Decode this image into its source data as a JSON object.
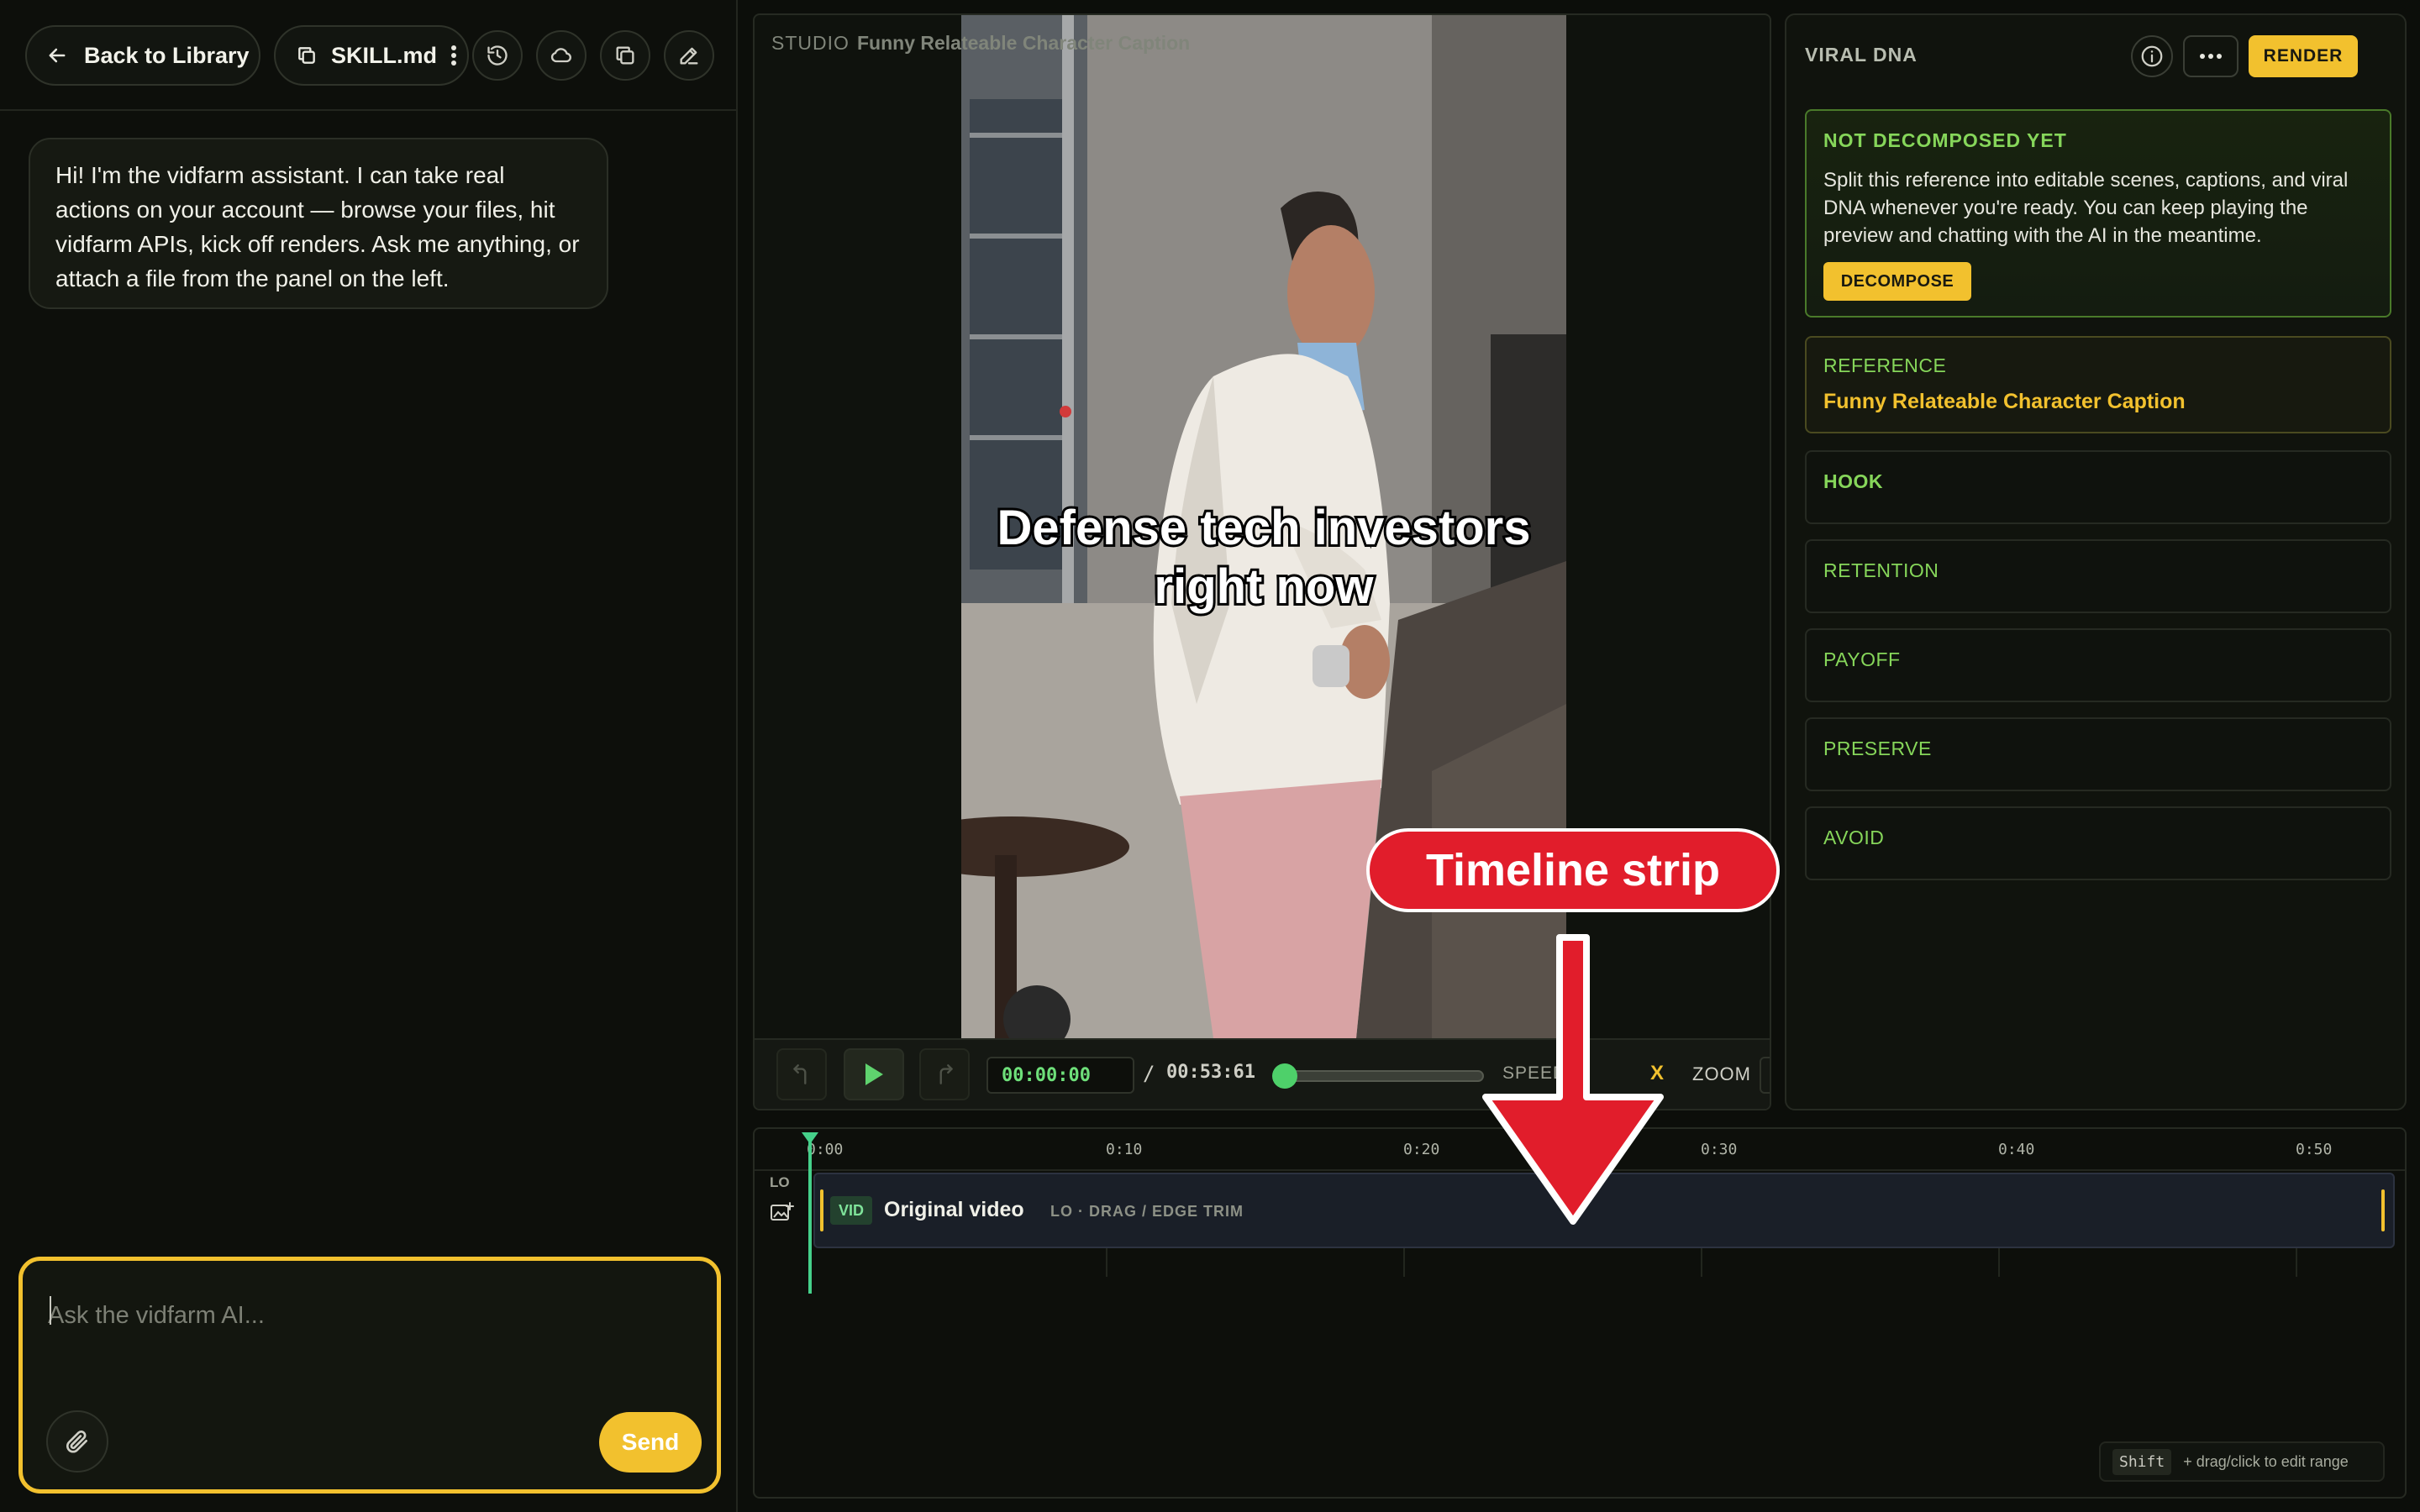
{
  "left_panel": {
    "back_label": "Back to Library",
    "skill_label": "SKILL.md",
    "assistant_message": "Hi! I'm the vidfarm assistant. I can take real actions on your account — browse your files, hit vidfarm APIs, kick off renders. Ask me anything, or attach a file from the panel on the left.",
    "composer": {
      "placeholder": "Ask the vidfarm AI...",
      "send_label": "Send"
    }
  },
  "studio": {
    "label": "STUDIO",
    "title": "Funny Relateable Character Caption",
    "video_caption": "Defense tech investors right now",
    "controls": {
      "current_time": "00:00:00",
      "separator": "/",
      "duration": "00:53:61",
      "progress": 0,
      "speed_label": "SPEED",
      "speed_x": "X",
      "zoom_label": "ZOOM"
    }
  },
  "viral_dna": {
    "title": "VIRAL DNA",
    "render_label": "RENDER",
    "status": {
      "title": "NOT DECOMPOSED YET",
      "body": "Split this reference into editable scenes, captions, and viral DNA whenever you're ready. You can keep playing the preview and chatting with the AI in the meantime.",
      "button": "DECOMPOSE"
    },
    "reference": {
      "label": "REFERENCE",
      "value": "Funny Relateable Character Caption"
    },
    "sections": [
      "HOOK",
      "RETENTION",
      "PAYOFF",
      "PRESERVE",
      "AVOID"
    ]
  },
  "timeline": {
    "ticks": [
      "0:00",
      "0:10",
      "0:20",
      "0:30",
      "0:40",
      "0:50"
    ],
    "lane_label": "LO",
    "clip": {
      "badge": "VID",
      "title": "Original video",
      "subtitle": "LO · DRAG / EDGE TRIM"
    },
    "hint": {
      "key": "Shift",
      "text": "+ drag/click to edit range"
    }
  },
  "annotation": {
    "label": "Timeline strip"
  },
  "colors": {
    "accent_yellow": "#f2c12e",
    "accent_green": "#86d65a",
    "timecode_green": "#6ee07a",
    "callout_red": "#e11d2b"
  }
}
